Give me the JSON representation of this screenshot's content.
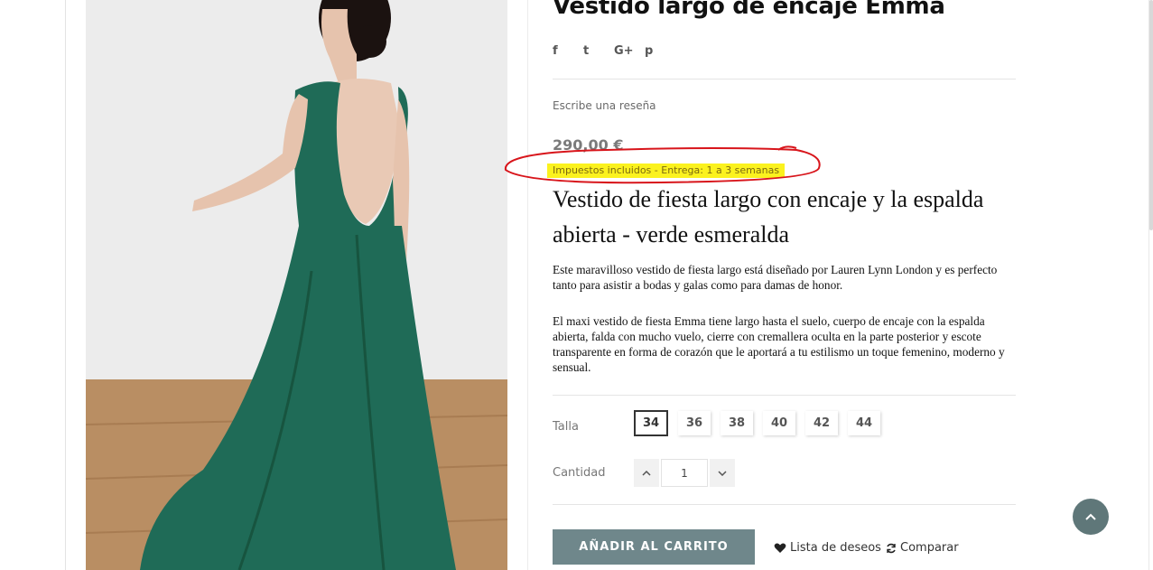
{
  "product": {
    "title": "Vestido largo de encaje Emma",
    "review_link": "Escribe una reseña",
    "price": "290,00 €",
    "tax_note": "Impuestos incluidos - Entrega: 1 a 3 semanas",
    "subtitle": "Vestido de fiesta largo con encaje y la espalda abierta - verde esmeralda",
    "description": [
      "Este maravilloso vestido de fiesta largo está diseñado por Lauren Lynn London y es perfecto tanto para asistir a bodas y galas como para damas de honor.",
      "El maxi vestido de fiesta Emma tiene largo hasta el suelo, cuerpo de encaje con la espalda abierta, falda con mucho vuelo, cierre con cremallera oculta en la parte posterior y escote transparente en forma de corazón que le aportará a tu estilismo un toque femenino, moderno y sensual."
    ]
  },
  "social": [
    "f",
    "t",
    "G+",
    "p"
  ],
  "size": {
    "label": "Talla",
    "options": [
      "34",
      "36",
      "38",
      "40",
      "42",
      "44"
    ],
    "selected": "34"
  },
  "quantity": {
    "label": "Cantidad",
    "value": "1"
  },
  "actions": {
    "add_to_cart": "AÑADIR AL CARRITO",
    "wishlist": "Lista de deseos",
    "compare": "Comparar"
  },
  "colors": {
    "accent": "#6f878b",
    "dress_green": "#1f6b57",
    "highlight": "#fbf21e",
    "annotation": "#d8151b"
  }
}
